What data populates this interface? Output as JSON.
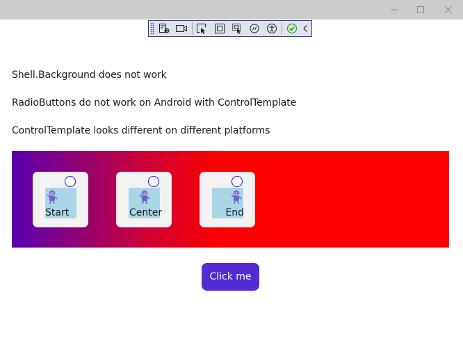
{
  "window": {
    "controls": [
      "minimize-icon",
      "maximize-icon",
      "close-icon"
    ]
  },
  "debug_toolbar": {
    "buttons": [
      "live-visual-tree-icon",
      "video-camera-icon",
      "select-element-icon",
      "display-layout-adorners-icon",
      "track-focus-icon",
      "binding-failures-icon",
      "accessibility-icon",
      "hot-reload-check-icon",
      "collapse-chevron-icon"
    ]
  },
  "issues": [
    "Shell.Background does not work",
    "RadioButtons do not work on Android with ControlTemplate",
    "ControlTemplate looks different on different platforms"
  ],
  "radio_buttons": [
    {
      "label": "Start",
      "checked": false
    },
    {
      "label": "Center",
      "checked": false
    },
    {
      "label": "End",
      "checked": false
    }
  ],
  "panel": {
    "gradient_start": "#5a00b0",
    "gradient_end": "#ff0000"
  },
  "button": {
    "label": "Click me",
    "color": "#512bd4"
  }
}
